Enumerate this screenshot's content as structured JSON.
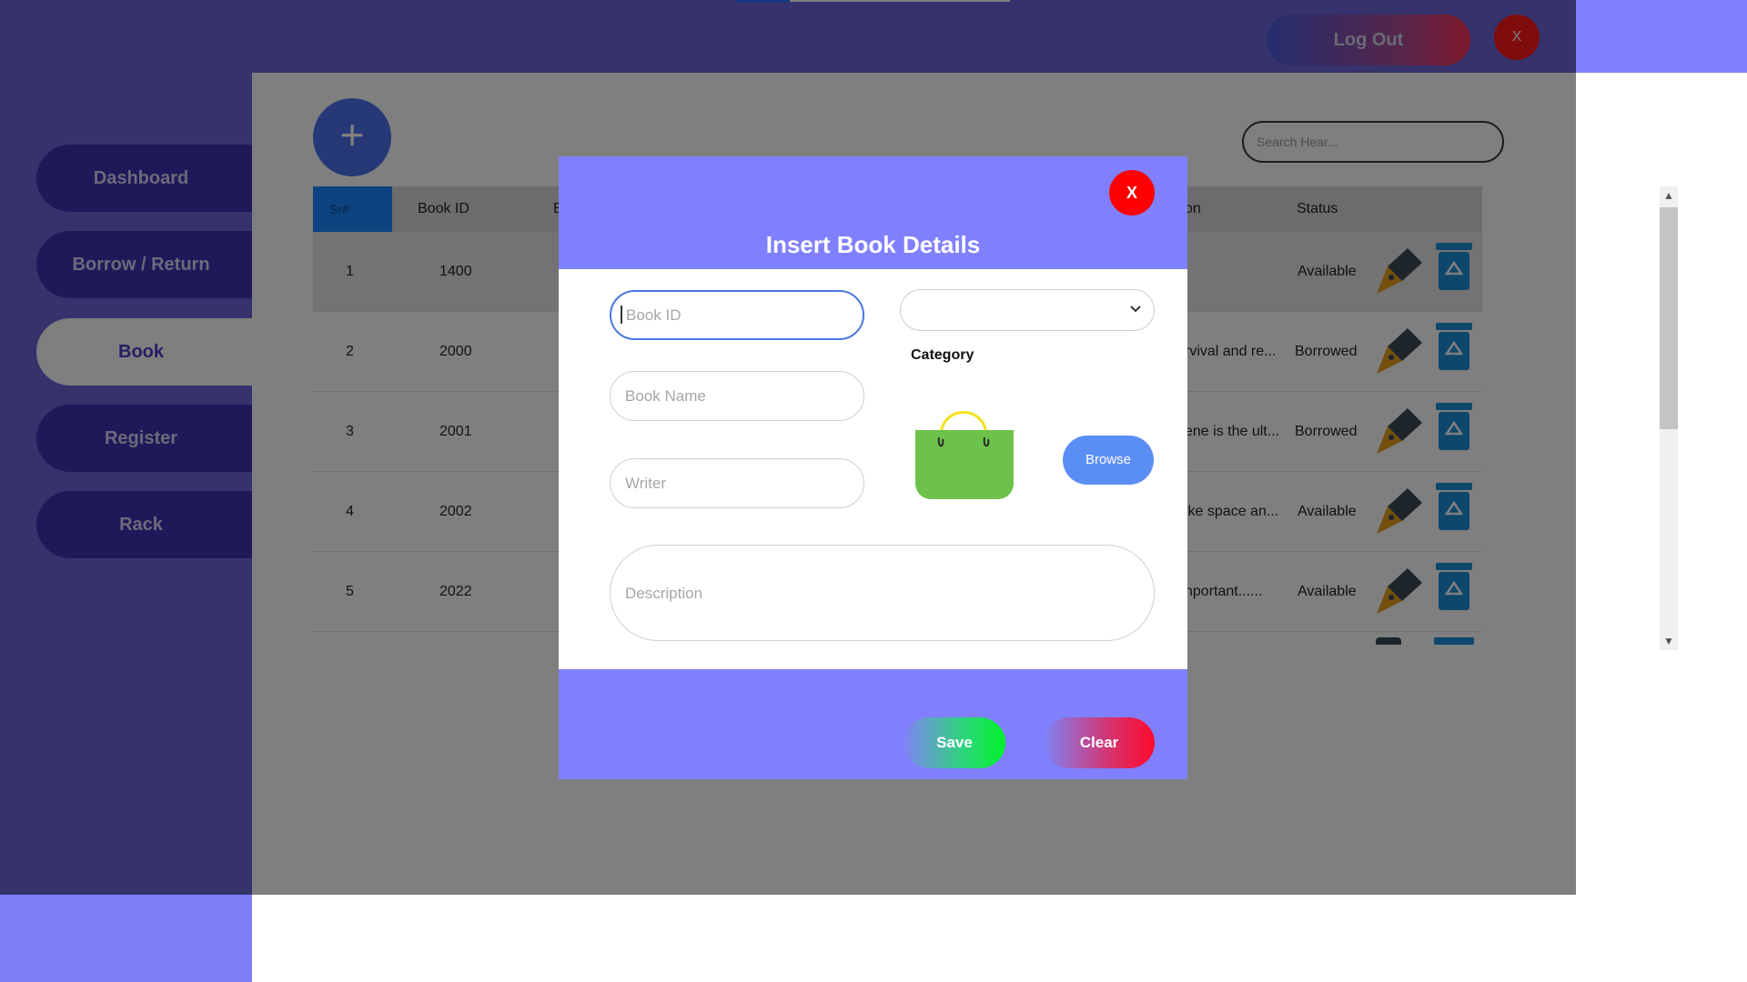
{
  "sidebar": {
    "items": [
      {
        "label": "Dashboard"
      },
      {
        "label": "Borrow / Return"
      },
      {
        "label": "Book"
      },
      {
        "label": "Register"
      },
      {
        "label": "Rack"
      }
    ]
  },
  "header": {
    "logout_label": "Log Out",
    "close_label": "X"
  },
  "toolbar": {
    "add_label": "+",
    "search_placeholder": "Search Hear..."
  },
  "table": {
    "headers": {
      "sr": "Sr#",
      "book_id": "Book ID",
      "desc_tail": "on",
      "status": "Status",
      "partial": "B"
    },
    "rows": [
      {
        "sr": "1",
        "book_id": "1400",
        "desc": "",
        "status": "Available"
      },
      {
        "sr": "2",
        "book_id": "2000",
        "desc": "rvival and re...",
        "status": "Borrowed"
      },
      {
        "sr": "3",
        "book_id": "2001",
        "desc": "ene is the ult...",
        "status": "Borrowed"
      },
      {
        "sr": "4",
        "book_id": "2002",
        "desc": "ike space an...",
        "status": "Available"
      },
      {
        "sr": "5",
        "book_id": "2022",
        "desc": "nportant......",
        "status": "Available"
      }
    ]
  },
  "modal": {
    "title": "Insert Book Details",
    "close_label": "X",
    "book_id_placeholder": "Book ID",
    "book_name_placeholder": "Book Name",
    "writer_placeholder": "Writer",
    "description_placeholder": "Description",
    "category_label": "Category",
    "category_value": "",
    "browse_label": "Browse",
    "save_label": "Save",
    "clear_label": "Clear"
  },
  "colors": {
    "accent": "#8080ff",
    "sidebar": "#6a65d8",
    "nav_button": "#3f32b4",
    "close_red": "#ff0000",
    "browse_blue": "#5b8ef5",
    "add_blue": "#4c73ec"
  },
  "icons": [
    "plus-icon",
    "pen-icon",
    "recycle-bin-icon",
    "shopping-bag-icon",
    "chevron-down-icon",
    "chevron-up-icon"
  ]
}
